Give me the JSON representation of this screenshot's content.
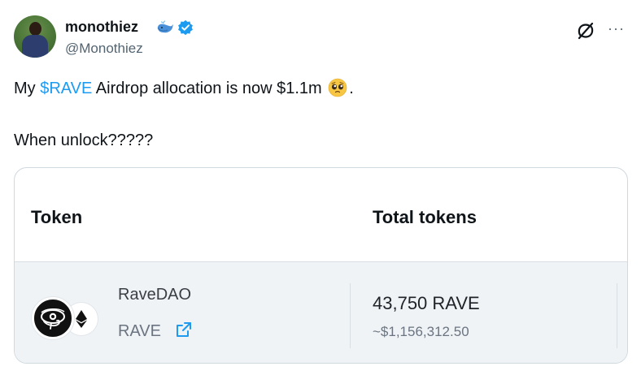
{
  "author": {
    "name": "monothiez",
    "handle": "@Monothiez"
  },
  "tweet": {
    "line1_prefix": "My ",
    "cashtag": "$RAVE",
    "line1_suffix": " Airdrop allocation is now $1.1m",
    "line1_end": ".",
    "line2": "When unlock?????"
  },
  "icons": {
    "badge": "whale-icon",
    "verified": "verified-badge-icon",
    "action": "grok-icon",
    "menu": "more-icon",
    "emoji": "pleading-face-icon",
    "token": "ravedao-eye-logo",
    "chain": "ethereum-icon",
    "link": "external-link-icon"
  },
  "colors": {
    "accent": "#1d9bf0",
    "card_row_bg": "#eff3f6"
  },
  "card": {
    "col_token": "Token",
    "col_total": "Total tokens",
    "row": {
      "name": "RaveDAO",
      "symbol": "RAVE",
      "amount": "43,750 RAVE",
      "usd_value": "~$1,156,312.50"
    }
  },
  "more_label": "···"
}
